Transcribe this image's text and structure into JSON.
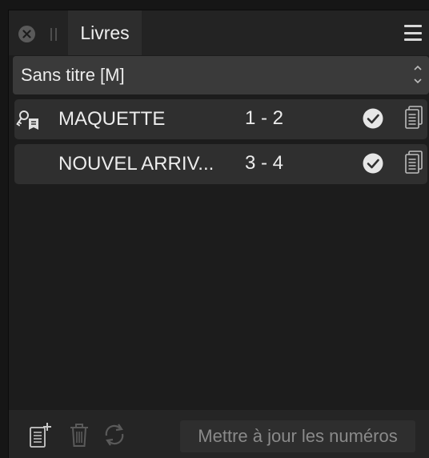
{
  "panel": {
    "tab_label": "Livres",
    "book_select": {
      "selected": "Sans titre [M]"
    },
    "documents": [
      {
        "name": "MAQUETTE",
        "pages": "1 - 2",
        "is_master": true,
        "status": "check-circle-icon"
      },
      {
        "name": "NOUVEL ARRIV...",
        "pages": "3 - 4",
        "is_master": false,
        "status": "check-circle-icon"
      }
    ],
    "footer": {
      "update_numbers_label": "Mettre à jour les numéros"
    }
  },
  "colors": {
    "background": "#1c1c1c",
    "row": "#2f2f2f",
    "select": "#3a3a3a",
    "text": "#ececec",
    "disabled_text": "#8a8a8a",
    "icon": "#d8d8d8"
  }
}
